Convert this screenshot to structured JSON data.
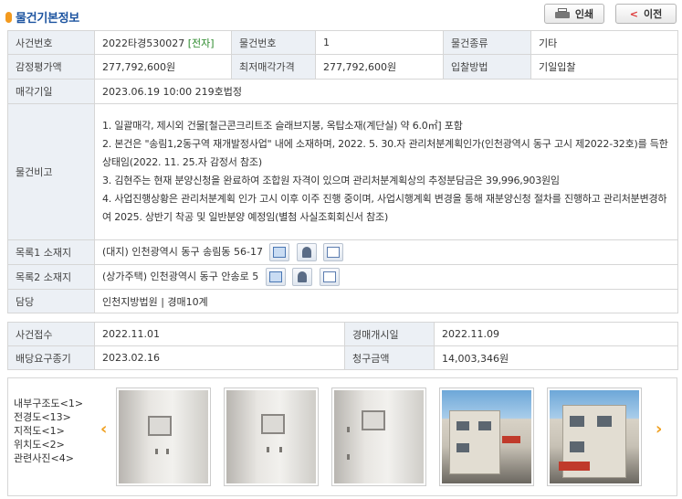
{
  "header": {
    "title": "물건기본정보",
    "print_label": "인쇄",
    "back_label": "이전"
  },
  "info": {
    "case_no_label": "사건번호",
    "case_no": "2022타경530027",
    "case_tag": "[전자]",
    "item_no_label": "물건번호",
    "item_no": "1",
    "item_type_label": "물건종류",
    "item_type": "기타",
    "appraisal_label": "감정평가액",
    "appraisal": "277,792,600원",
    "min_price_label": "최저매각가격",
    "min_price": "277,792,600원",
    "bid_method_label": "입찰방법",
    "bid_method": "기일입찰",
    "sale_date_label": "매각기일",
    "sale_date": "2023.06.19 10:00 219호법정",
    "notes_label": "물건비고",
    "notes": [
      "1. 일괄매각, 제시외 건물[철근콘크리트조 슬래브지붕, 옥탑소재(계단실) 약 6.0㎡] 포함",
      "2. 본건은 \"송림1,2동구역 재개발정사업\" 내에 소재하며, 2022. 5. 30.자 관리처분계획인가(인천광역시 동구 고시 제2022-32호)를 득한 상태임(2022. 11. 25.자 감정서 참조)",
      "3. 김현주는 현재 분양신청을 완료하여 조합원 자격이 있으며 관리처분계획상의 추정분담금은 39,996,903원임",
      "4. 사업진행상황은 관리처분계획 인가 고시 이후 이주 진행 중이며, 사업시행계획 변경을 통해 재분양신청 절차를 진행하고 관리처분변경하여 2025. 상반기 착공 및 일반분양 예정임(별첨 사실조회회신서 참조)"
    ],
    "list1_label": "목록1 소재지",
    "list1": "(대지) 인천광역시 동구 송림동 56-17",
    "list2_label": "목록2 소재지",
    "list2": "(상가주택) 인천광역시 동구 안송로 5",
    "charge_label": "담당",
    "charge": "인천지방법원 | 경매10계"
  },
  "case": {
    "received_label": "사건접수",
    "received": "2022.11.01",
    "start_label": "경매개시일",
    "start": "2022.11.09",
    "deadline_label": "배당요구종기",
    "deadline": "2023.02.16",
    "claim_label": "청구금액",
    "claim": "14,003,346원"
  },
  "photos": {
    "links": [
      "내부구조도<1>",
      "전경도<13>",
      "지적도<1>",
      "위치도<2>",
      "관련사진<4>"
    ],
    "prev_glyph": "‹",
    "next_glyph": "›"
  },
  "icons": {
    "map": "map-icon",
    "person": "person-icon",
    "real": "real-estate-icon"
  },
  "colors": {
    "title": "#1d54a0",
    "label_bg": "#ecf0f5",
    "tag": "#2c8a2c",
    "arrow": "#f0a020"
  }
}
